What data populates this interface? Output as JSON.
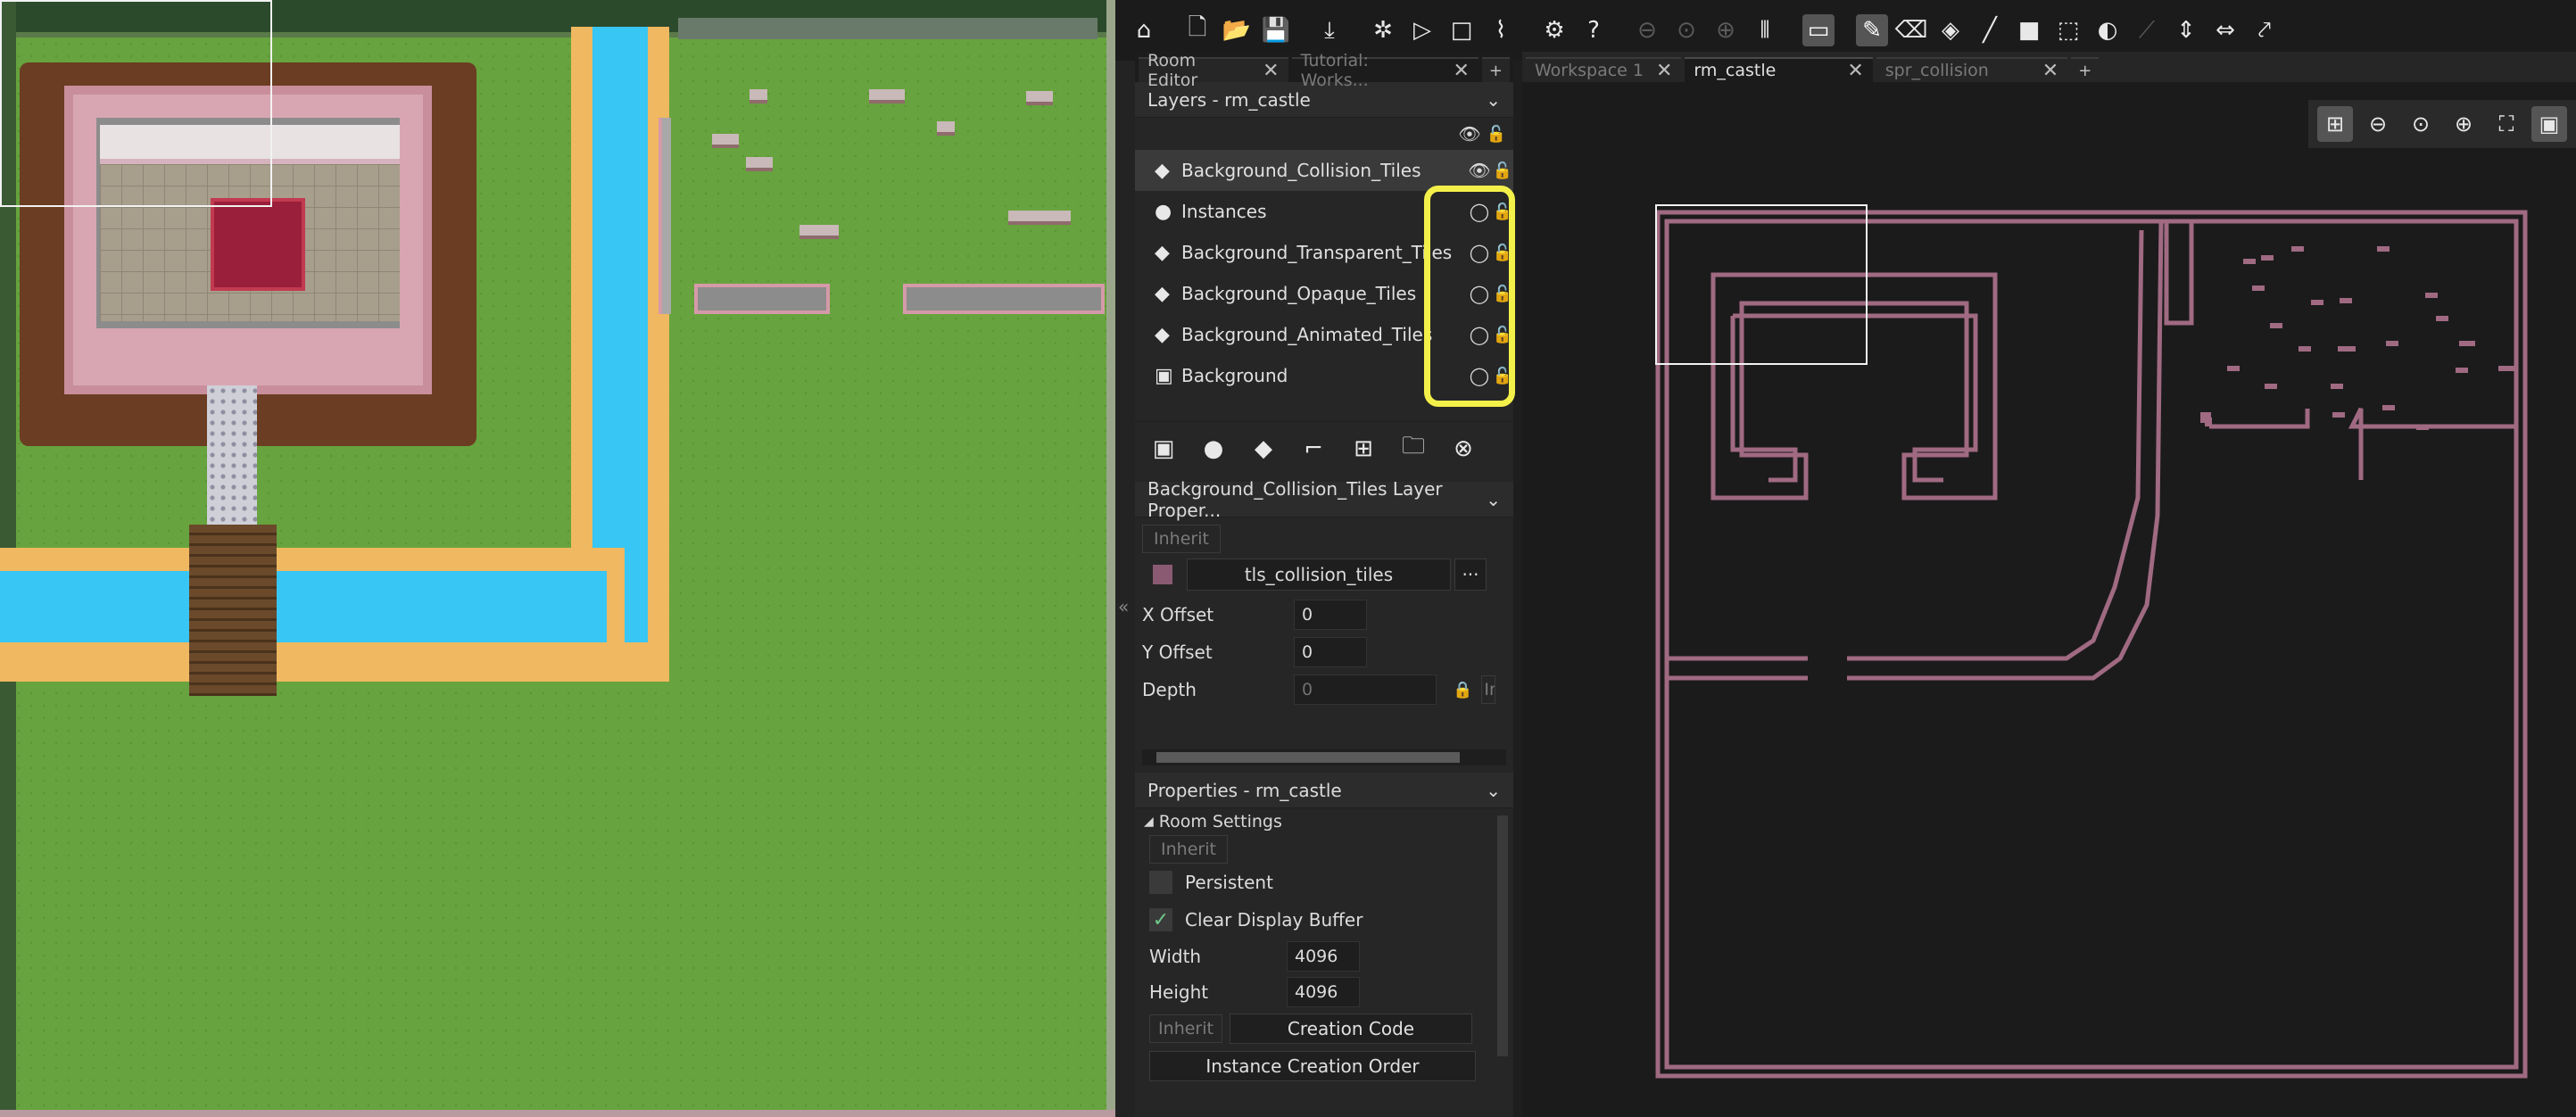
{
  "colors": {
    "accent_highlight": "#f4f04a",
    "collision_tile": "#a06a82",
    "grass": "#67a33e",
    "water": "#38c6f4",
    "sand": "#f0b860",
    "carpet": "#9a1f3a"
  },
  "toolbar": {
    "icons": [
      "home-icon",
      "new-file-icon",
      "open-folder-icon",
      "save-icon",
      "create-executable-icon",
      "debug-icon",
      "play-icon",
      "stop-icon",
      "clean-icon",
      "settings-icon",
      "help-icon",
      "zoom-out-icon",
      "zoom-reset-icon",
      "zoom-in-icon",
      "split-view-icon",
      "monitor-icon",
      "pencil-icon",
      "eraser-icon",
      "fill-icon",
      "line-icon",
      "rectangle-icon",
      "select-icon",
      "inherit-icon",
      "pick-icon",
      "flip-vertical-icon",
      "flip-horizontal-icon",
      "rotate-icon"
    ]
  },
  "left_tabs": [
    {
      "label": "Room Editor",
      "close": "✕"
    },
    {
      "label": "Tutorial: Works...",
      "close": "✕"
    }
  ],
  "room_tabs": [
    {
      "label": "Workspace 1",
      "close": "✕"
    },
    {
      "label": "rm_castle",
      "close": "✕"
    },
    {
      "label": "spr_collision",
      "close": "✕"
    }
  ],
  "tab_plus": "+",
  "layers": {
    "header": "Layers - rm_castle",
    "items": [
      {
        "name": "Background_Collision_Tiles",
        "icon": "tile-layer-icon",
        "visible": true
      },
      {
        "name": "Instances",
        "icon": "instance-layer-icon",
        "visible": false
      },
      {
        "name": "Background_Transparent_Tiles",
        "icon": "tile-layer-icon",
        "visible": false
      },
      {
        "name": "Background_Opaque_Tiles",
        "icon": "tile-layer-icon",
        "visible": false
      },
      {
        "name": "Background_Animated_Tiles",
        "icon": "tile-layer-icon",
        "visible": false
      },
      {
        "name": "Background",
        "icon": "background-layer-icon",
        "visible": false
      }
    ]
  },
  "layer_props": {
    "header": "Background_Collision_Tiles Layer Proper...",
    "inherit": "Inherit",
    "tileset": "tls_collision_tiles",
    "more": "···",
    "x_offset_label": "X Offset",
    "x_offset": "0",
    "y_offset_label": "Y Offset",
    "y_offset": "0",
    "depth_label": "Depth",
    "depth": "0",
    "cut_label": "In"
  },
  "room_props": {
    "header": "Properties - rm_castle",
    "room_settings": "Room Settings",
    "inherit": "Inherit",
    "persistent": "Persistent",
    "persistent_checked": false,
    "clear_buffer": "Clear Display Buffer",
    "clear_buffer_checked": true,
    "width_label": "Width",
    "width": "4096",
    "height_label": "Height",
    "height": "4096",
    "inherit2": "Inherit",
    "creation_code": "Creation Code",
    "instance_order": "Instance Creation Order"
  }
}
